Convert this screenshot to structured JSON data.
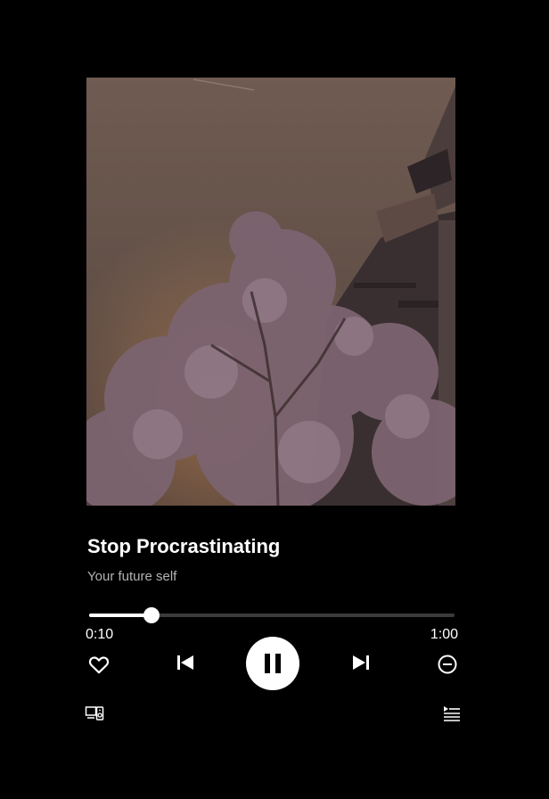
{
  "track": {
    "title": "Stop Procrastinating",
    "artist": "Your future self"
  },
  "playback": {
    "elapsed": "0:10",
    "duration": "1:00",
    "progress_fraction": 0.17,
    "state": "playing"
  },
  "icons": {
    "like": "heart-icon",
    "previous": "skip-previous-icon",
    "play_pause": "pause-icon",
    "next": "skip-next-icon",
    "remove": "minus-circle-icon",
    "devices": "connect-devices-icon",
    "queue": "queue-icon"
  },
  "colors": {
    "background": "#000000",
    "text_primary": "#ffffff",
    "text_secondary": "#b3b3b3",
    "progress_track": "#3b3b3b",
    "progress_fill": "#ffffff"
  }
}
